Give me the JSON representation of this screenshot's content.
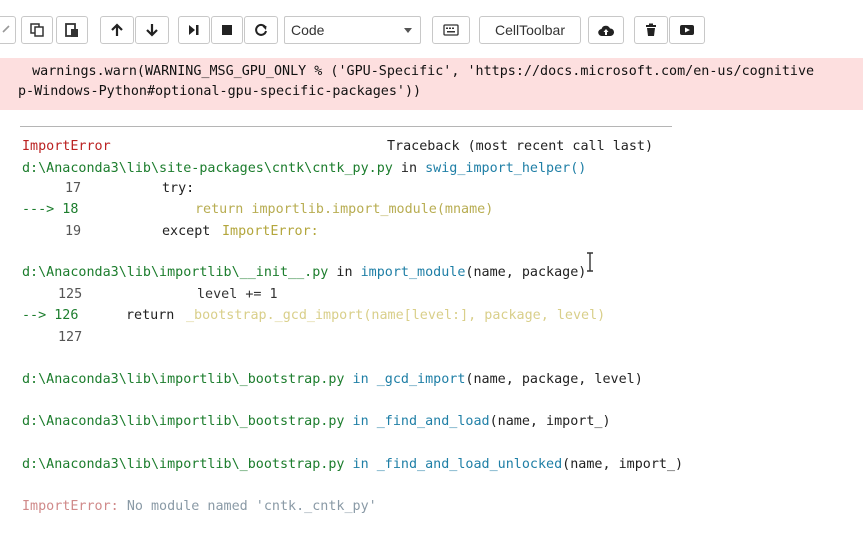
{
  "toolbar": {
    "cell_type_value": "Code",
    "celltoolbar_label": "CellToolbar",
    "icons": [
      "scissors-icon",
      "copy-icon",
      "paste-icon",
      "arrow-up-icon",
      "arrow-down-icon",
      "run-icon",
      "stop-icon",
      "restart-icon",
      "keyboard-icon",
      "upload-icon",
      "trash-icon",
      "present-icon"
    ]
  },
  "stderr": {
    "line1": "  warnings.warn(WARNING_MSG_GPU_ONLY % ('GPU-Specific', 'https://docs.microsoft.com/en-us/cognitive",
    "line2": "p-Windows-Python#optional-gpu-specific-packages'))"
  },
  "traceback": {
    "error_name": "ImportError",
    "header_right": "Traceback (most recent call last)",
    "frame1": {
      "path": "d:\\Anaconda3\\lib\\site-packages\\cntk\\cntk_py.py",
      "in": "in",
      "func": "swig_import_helper()",
      "l17_num": "17",
      "l17_code": "try:",
      "l18_arrow": "---> 18",
      "l18_code": "return importlib.import_module(mname)",
      "l19_num": "19",
      "l19_kw": "except",
      "l19_exc": "ImportError:"
    },
    "frame2": {
      "path": "d:\\Anaconda3\\lib\\importlib\\__init__.py",
      "in": "in",
      "func": "import_module",
      "args": "(name, package)",
      "l125_num": "125",
      "l125_code": "level += 1",
      "l126_arrow": "--> 126",
      "l126_kw": "return",
      "l126_code": "_bootstrap._gcd_import(name[level:], package, level)",
      "l127_num": "127"
    },
    "frame3": {
      "path": "d:\\Anaconda3\\lib\\importlib\\_bootstrap.py",
      "in": "in",
      "func": "_gcd_import",
      "args": "(name, package, level)"
    },
    "frame4": {
      "path": "d:\\Anaconda3\\lib\\importlib\\_bootstrap.py",
      "in": "in",
      "func": "_find_and_load",
      "args": "(name, import_)"
    },
    "frame5": {
      "path": "d:\\Anaconda3\\lib\\importlib\\_bootstrap.py",
      "in": "in",
      "func": "_find_and_load_unlocked",
      "args": "(name, import_)"
    },
    "final_error_name": "ImportError:",
    "final_error_msg": "No module named 'cntk._cntk_py'"
  }
}
